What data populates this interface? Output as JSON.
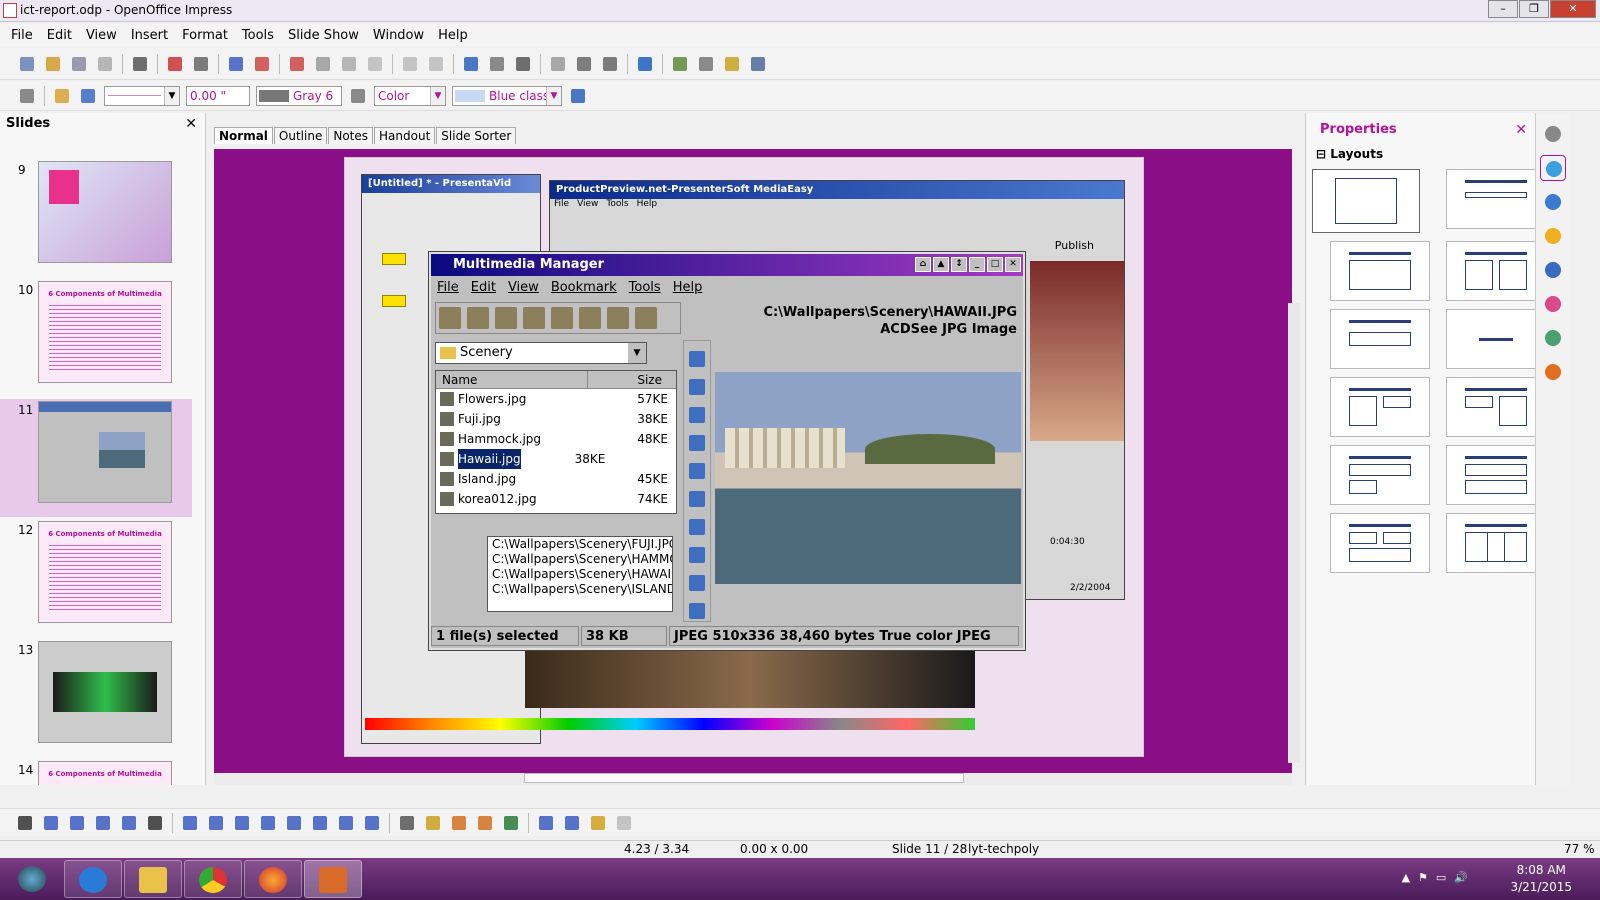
{
  "window": {
    "title": "ict-report.odp - OpenOffice Impress"
  },
  "menu": [
    "File",
    "Edit",
    "View",
    "Insert",
    "Format",
    "Tools",
    "Slide Show",
    "Window",
    "Help"
  ],
  "formatbar": {
    "line_width": "0.00 \"",
    "area_color": "Gray 6",
    "fill_type": "Color",
    "fill_value": "Blue classic"
  },
  "slides_panel": {
    "title": "Slides",
    "slides": [
      {
        "number": "9",
        "title": ""
      },
      {
        "number": "10",
        "title": "6 Components of Multimedia"
      },
      {
        "number": "11",
        "title": ""
      },
      {
        "number": "12",
        "title": "6 Components of Multimedia"
      },
      {
        "number": "13",
        "title": ""
      },
      {
        "number": "14",
        "title": "6 Components of Multimedia"
      }
    ],
    "selected": "11"
  },
  "view_tabs": [
    "Normal",
    "Outline",
    "Notes",
    "Handout",
    "Slide Sorter"
  ],
  "slide_content": {
    "back_window_1": "[Untitled] * - PresentaVid",
    "back_window_2": "ProductPreview.net-PresenterSoft MediaEasy",
    "back_window_2_menu": [
      "File",
      "View",
      "Tools",
      "Help"
    ],
    "publish_label": "Publish",
    "timeline_a": "0:04:30",
    "timeline_b": "2/2/2004",
    "multimedia_manager": {
      "title": "Multimedia Manager",
      "menu": [
        "File",
        "Edit",
        "View",
        "Bookmark",
        "Tools",
        "Help"
      ],
      "path": "C:\\Wallpapers\\Scenery\\HAWAII.JPG",
      "type": "ACDSee JPG Image",
      "folder": "Scenery",
      "columns": {
        "name": "Name",
        "size": "Size"
      },
      "files": [
        {
          "name": "Flowers.jpg",
          "size": "57KE"
        },
        {
          "name": "Fuji.jpg",
          "size": "38KE"
        },
        {
          "name": "Hammock.jpg",
          "size": "48KE"
        },
        {
          "name": "Hawaii.jpg",
          "size": "38KE"
        },
        {
          "name": "Island.jpg",
          "size": "45KE"
        },
        {
          "name": "korea012.jpg",
          "size": "74KE"
        }
      ],
      "selected_file": "Hawaii.jpg",
      "playlist": [
        "C:\\Wallpapers\\Scenery\\FUJI.JPG",
        "C:\\Wallpapers\\Scenery\\HAMMOC",
        "C:\\Wallpapers\\Scenery\\HAWAII.J",
        "C:\\Wallpapers\\Scenery\\ISLAND.J"
      ],
      "status": {
        "selected": "1 file(s) selected",
        "size": "38 KB",
        "info": "JPEG   510x336   38,460 bytes   True color   JPEG"
      }
    }
  },
  "properties": {
    "title": "Properties",
    "section": "Layouts"
  },
  "status_bar": {
    "position": "4.23 / 3.34",
    "size": "0.00 x 0.00",
    "slide": "Slide 11 / 28",
    "master": "lyt-techpoly",
    "zoom": "77 %"
  },
  "taskbar": {
    "time": "8:08 AM",
    "date": "3/21/2015"
  },
  "colors": {
    "accent": "#b3139a",
    "slide_bg": "#8a0f86",
    "taskbar": "#5c2a6a"
  }
}
